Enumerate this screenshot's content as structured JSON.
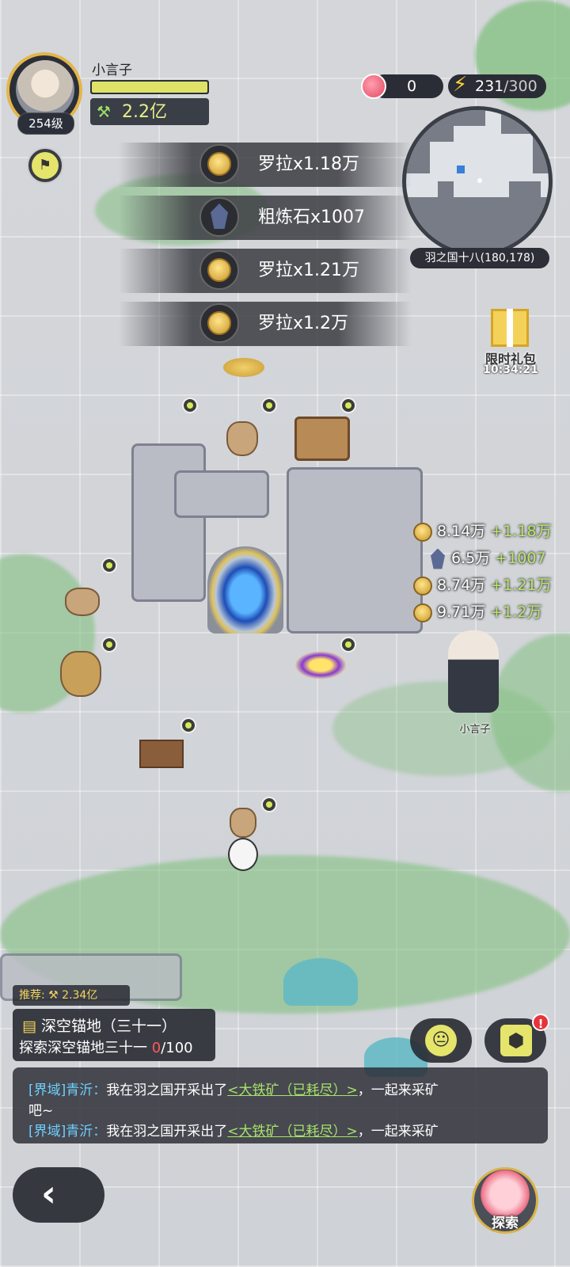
{
  "player": {
    "name": "小言子",
    "level": "254级",
    "power": "2.2亿"
  },
  "resources": {
    "apples": "0",
    "energy_current": "231",
    "energy_max": "/300"
  },
  "minimap": {
    "location": "羽之国十八(180,178)"
  },
  "rewards": [
    {
      "icon": "coin-icon",
      "text": "罗拉x1.18万"
    },
    {
      "icon": "crystal-icon",
      "text": "粗炼石x1007"
    },
    {
      "icon": "coin-icon",
      "text": "罗拉x1.21万"
    },
    {
      "icon": "coin-icon",
      "text": "罗拉x1.2万"
    }
  ],
  "gift": {
    "label": "限时礼包",
    "timer": "10:34:21"
  },
  "stats": [
    {
      "icon": "coin-icon",
      "value": "8.14万",
      "add": "+1.18万"
    },
    {
      "icon": "crystal-icon",
      "value": "6.5万",
      "add": "+1007"
    },
    {
      "icon": "coin-icon",
      "value": "8.74万",
      "add": "+1.21万"
    },
    {
      "icon": "coin-icon",
      "value": "9.71万",
      "add": "+1.2万"
    }
  ],
  "map_character": {
    "name": "小言子"
  },
  "quest": {
    "recommend": "推荐: ⚒ 2.34亿",
    "title": "深空锚地（三十一）",
    "desc_prefix": "探索深空锚地三十一 ",
    "progress_current": "0",
    "progress_total": "/100"
  },
  "chat": {
    "line1_channel": "[界域]青沂：",
    "line1_text": "我在羽之国开采出了",
    "line1_link": "<大铁矿（已耗尽）>",
    "line1_suffix": "，一起来采矿",
    "line2_text": "吧~",
    "line3_channel": "[界域]青沂：",
    "line3_text": "我在羽之国开采出了",
    "line3_link": "<大铁矿（已耗尽）>",
    "line3_suffix": "，一起来采矿"
  },
  "bottom": {
    "back_icon": "‹",
    "explore_label": "探索"
  },
  "notifications": {
    "badge": "!"
  },
  "colors": {
    "accent_yellow": "#e5e46b",
    "reward_text": "#ffffff",
    "stat_add": "#b9e76a",
    "chat_channel": "#6ed0ff",
    "chat_link": "#a6e36a",
    "progress_current": "#ff5a5a"
  }
}
